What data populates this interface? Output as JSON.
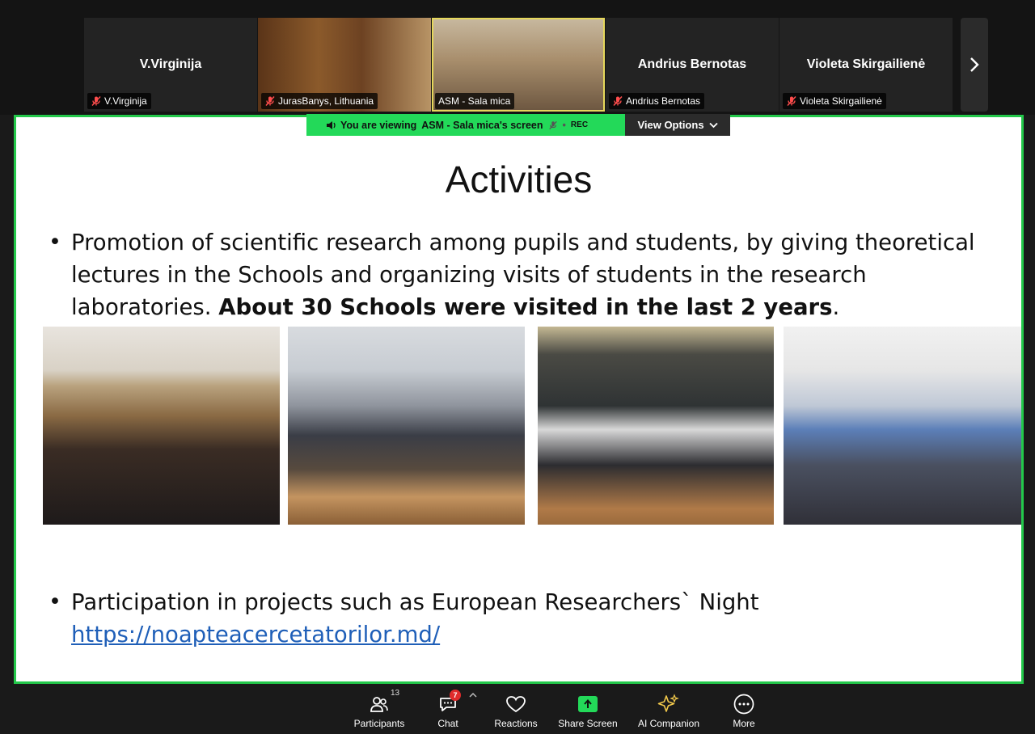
{
  "strip": {
    "tiles": [
      {
        "center_name": "V.Virginija",
        "label": "V.Virginija"
      },
      {
        "center_name": "",
        "label": "JurasBanys, Lithuania"
      },
      {
        "center_name": "",
        "label": "ASM - Sala mica"
      },
      {
        "center_name": "Andrius Bernotas",
        "label": "Andrius Bernotas"
      },
      {
        "center_name": "Violeta Skirgailienė",
        "label": "Violeta Skirgailienė"
      }
    ]
  },
  "banner": {
    "viewing_prefix": "You are viewing",
    "viewing_name": "ASM - Sala mica's screen",
    "rec": "REC",
    "view_options": "View Options"
  },
  "slide": {
    "title": "Activities",
    "bullet1_normal": "Promotion of scientific research among pupils and students, by giving theoretical lectures in the Schools and organizing visits of students in the research laboratories.",
    "bullet1_bold": "About 30 Schools were visited in the last 2 years",
    "bullet1_end": ".",
    "bullet2_text": "Participation in projects such as European Researchers` Night",
    "bullet2_link": "https://noapteacercetatorilor.md/"
  },
  "toolbar": {
    "participants_label": "Participants",
    "participants_count": "13",
    "chat_label": "Chat",
    "chat_badge": "7",
    "reactions_label": "Reactions",
    "share_label": "Share Screen",
    "ai_label": "AI Companion",
    "more_label": "More"
  },
  "colors": {
    "accent_green": "#23d959",
    "share_border": "#23c84a",
    "badge_red": "#e02b2b",
    "link_blue": "#1f5fb8"
  },
  "icons": [
    "mic-muted-icon",
    "chevron-right-icon",
    "speaker-icon",
    "chevron-down-icon",
    "participants-icon",
    "chat-icon",
    "heart-icon",
    "share-screen-icon",
    "sparkle-icon",
    "more-icon",
    "caret-up-icon"
  ]
}
